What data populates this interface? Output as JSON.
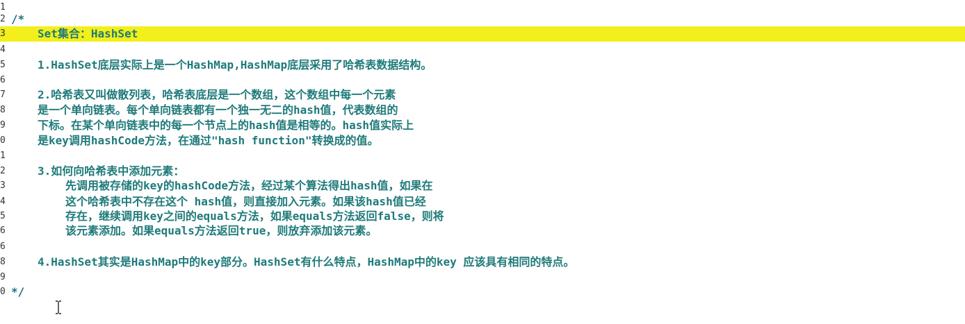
{
  "editor": {
    "lines": [
      {
        "no": "1",
        "text": ""
      },
      {
        "no": "2",
        "text": "/*"
      },
      {
        "no": "3",
        "text": "Set集合：HashSet"
      },
      {
        "no": "4",
        "text": ""
      },
      {
        "no": "5",
        "text": "1.HashSet底层实际上是一个HashMap,HashMap底层采用了哈希表数据结构。"
      },
      {
        "no": "6",
        "text": ""
      },
      {
        "no": "7",
        "text": "2.哈希表又叫做散列表，哈希表底层是一个数组，这个数组中每一个元素"
      },
      {
        "no": "8",
        "text": "是一个单向链表。每个单向链表都有一个独一无二的hash值，代表数组的"
      },
      {
        "no": "9",
        "text": "下标。在某个单向链表中的每一个节点上的hash值是相等的。hash值实际上"
      },
      {
        "no": "0",
        "text": "是key调用hashCode方法，在通过\"hash function\"转换成的值。"
      },
      {
        "no": "1",
        "text": ""
      },
      {
        "no": "2",
        "text": "3.如何向哈希表中添加元素："
      },
      {
        "no": "3",
        "text": "先调用被存储的key的hashCode方法，经过某个算法得出hash值，如果在"
      },
      {
        "no": "4",
        "text": "这个哈希表中不存在这个 hash值，则直接加入元素。如果该hash值已经"
      },
      {
        "no": "5",
        "text": "存在，继续调用key之间的equals方法，如果equals方法返回false，则将"
      },
      {
        "no": "6",
        "text": "该元素添加。如果equals方法返回true，则放弃添加该元素。"
      },
      {
        "no": "6",
        "text": ""
      },
      {
        "no": "8",
        "text": "4.HashSet其实是HashMap中的key部分。HashSet有什么特点，HashMap中的key 应该具有相同的特点。"
      },
      {
        "no": "9",
        "text": ""
      },
      {
        "no": "0",
        "text": "*/"
      }
    ],
    "cursor_icon": "text-ibeam-icon",
    "highlight_color": "#f2ef1a",
    "text_color": "#1f7a7a"
  }
}
